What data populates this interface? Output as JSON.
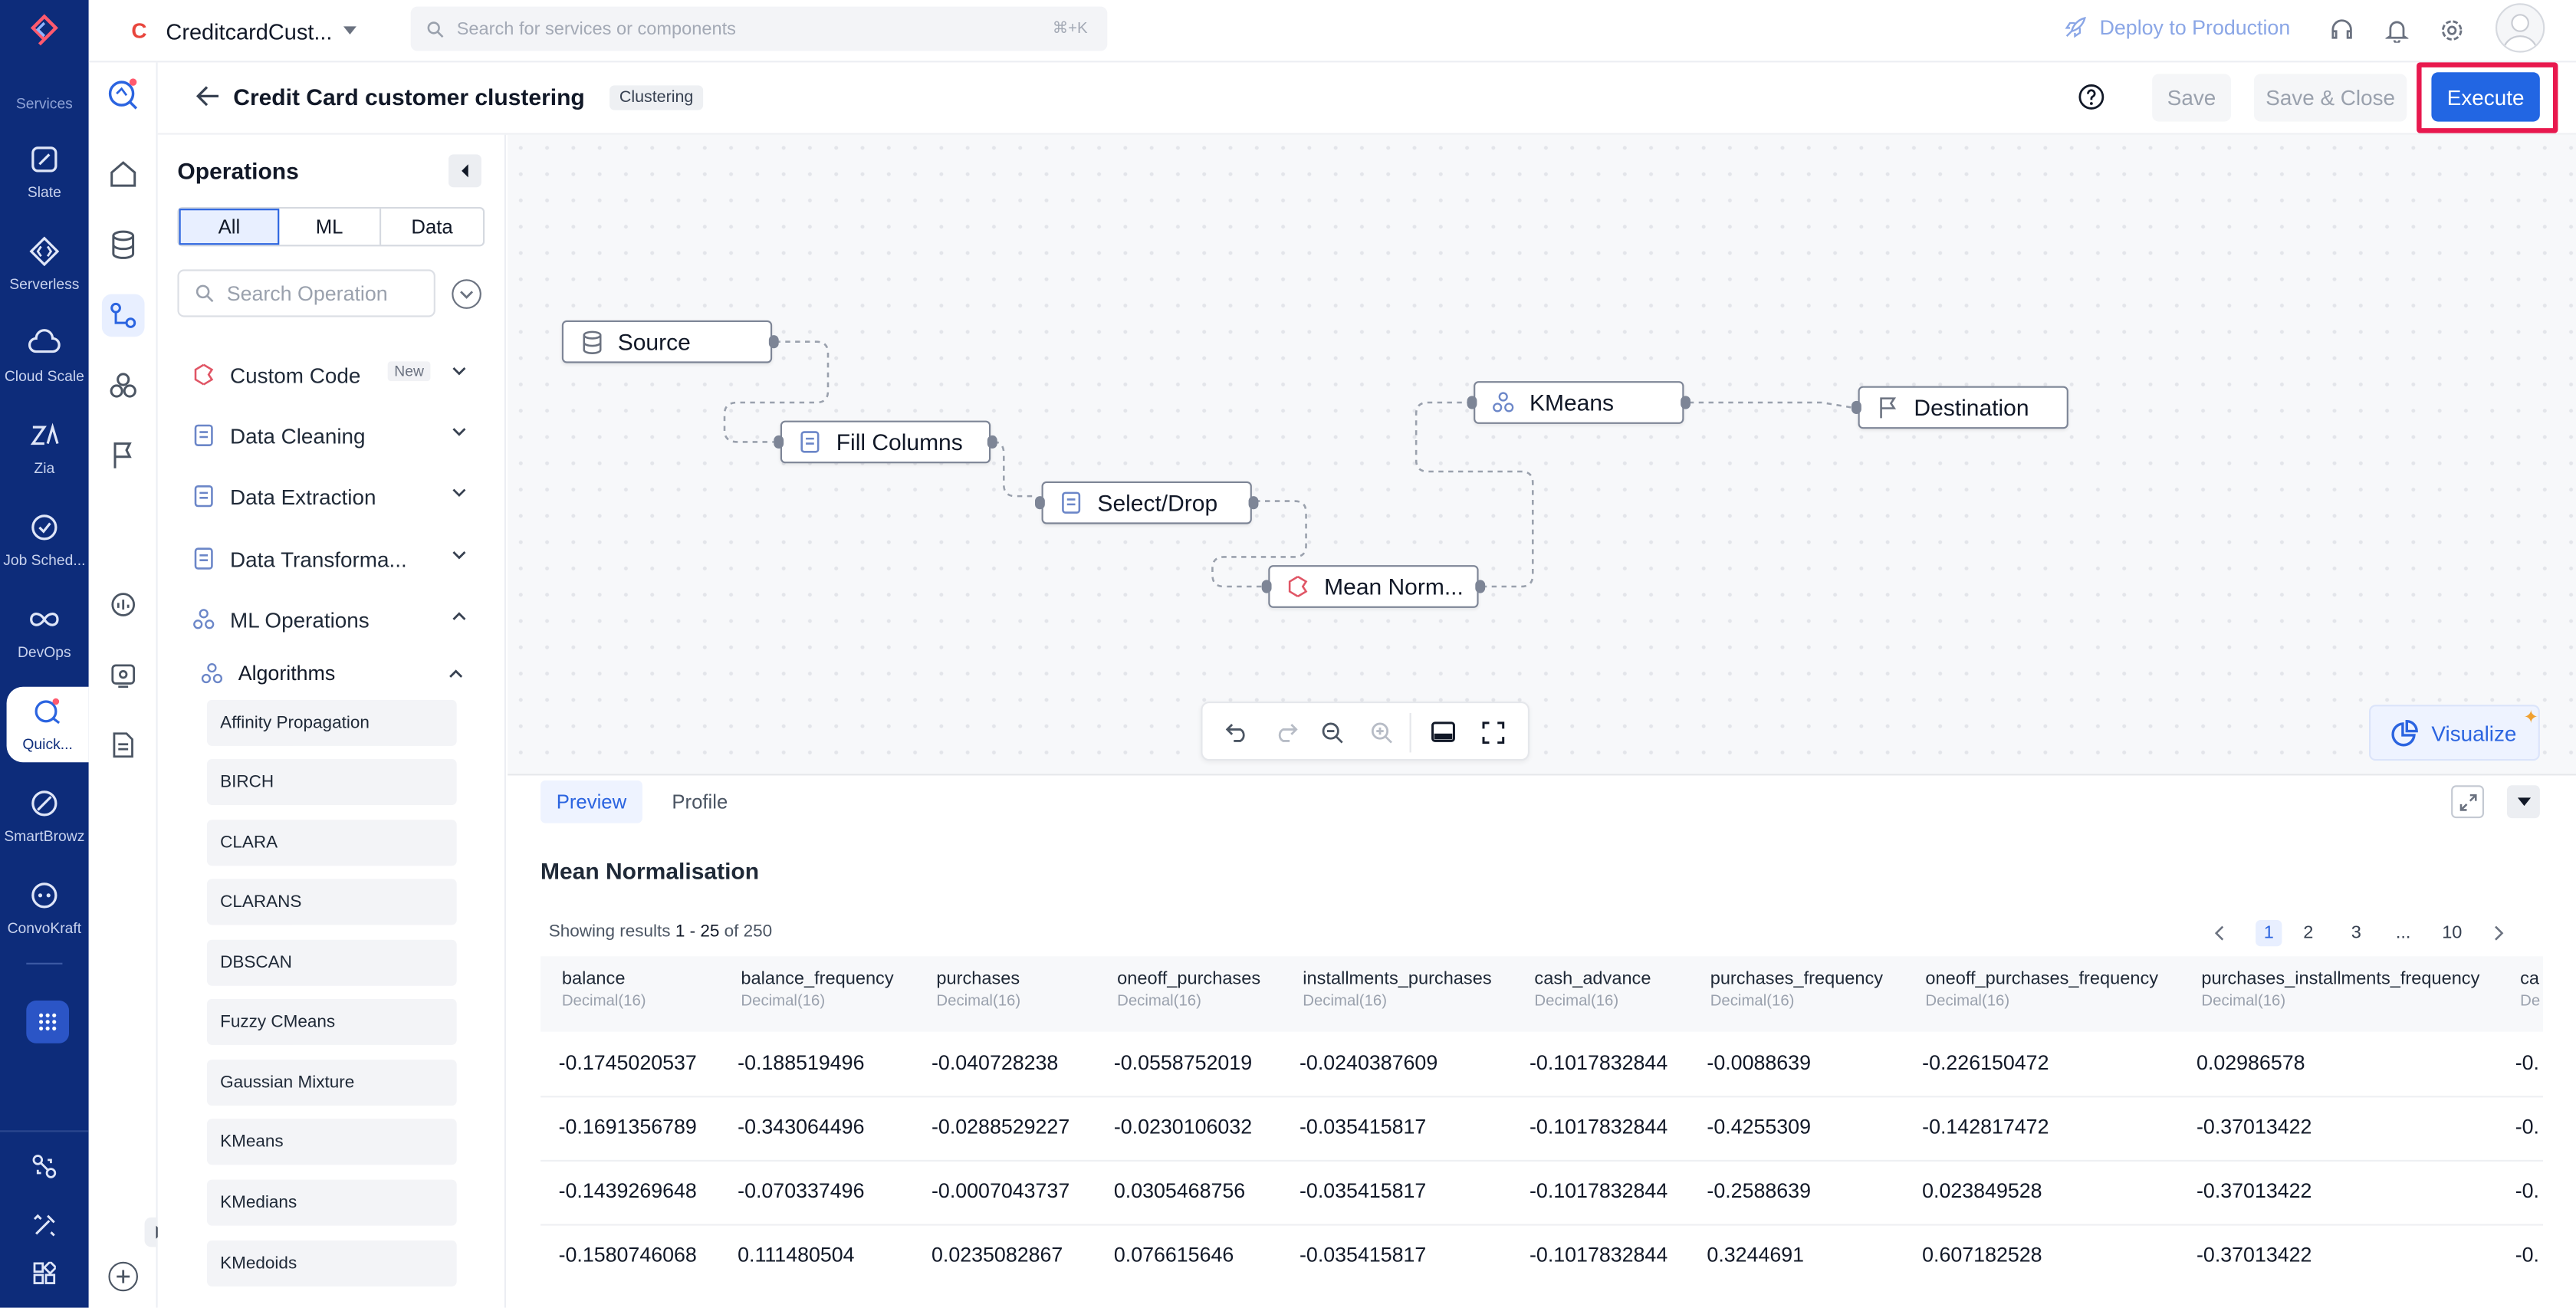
{
  "rail": {
    "section_label": "Services",
    "items": [
      {
        "label": "Slate"
      },
      {
        "label": "Serverless"
      },
      {
        "label": "Cloud Scale"
      },
      {
        "label": "Zia"
      },
      {
        "label": "Job Sched..."
      },
      {
        "label": "DevOps"
      },
      {
        "label": "Quick..."
      },
      {
        "label": "SmartBrowz"
      },
      {
        "label": "ConvoKraft"
      }
    ]
  },
  "topbar": {
    "project_initial": "C",
    "project_name": "CreditcardCust...",
    "search_placeholder": "Search for services or components",
    "search_shortcut": "⌘+K",
    "deploy_label": "Deploy to Production"
  },
  "header": {
    "title": "Credit Card customer clustering",
    "badge": "Clustering",
    "save_label": "Save",
    "save_close_label": "Save & Close",
    "execute_label": "Execute"
  },
  "panel": {
    "title": "Operations",
    "filters": [
      "All",
      "ML",
      "Data"
    ],
    "search_placeholder": "Search Operation",
    "categories": [
      {
        "label": "Custom Code",
        "badge": "New"
      },
      {
        "label": "Data Cleaning"
      },
      {
        "label": "Data Extraction"
      },
      {
        "label": "Data Transforma..."
      },
      {
        "label": "ML Operations"
      }
    ],
    "subcategory": "Algorithms",
    "algorithms": [
      "Affinity Propagation",
      "BIRCH",
      "CLARA",
      "CLARANS",
      "DBSCAN",
      "Fuzzy CMeans",
      "Gaussian Mixture",
      "KMeans",
      "KMedians",
      "KMedoids"
    ]
  },
  "canvas": {
    "nodes": {
      "source": "Source",
      "fill": "Fill Columns",
      "select": "Select/Drop",
      "mean": "Mean Norm...",
      "kmeans": "KMeans",
      "destination": "Destination"
    },
    "visualize_label": "Visualize"
  },
  "preview": {
    "tabs": [
      "Preview",
      "Profile"
    ],
    "title": "Mean Normalisation",
    "results_prefix": "Showing results ",
    "results_range": "1 - 25",
    "results_suffix": " of 250",
    "pages": [
      "1",
      "2",
      "3",
      "...",
      "10"
    ],
    "columns": [
      {
        "name": "balance",
        "type": "Decimal(16)"
      },
      {
        "name": "balance_frequency",
        "type": "Decimal(16)"
      },
      {
        "name": "purchases",
        "type": "Decimal(16)"
      },
      {
        "name": "oneoff_purchases",
        "type": "Decimal(16)"
      },
      {
        "name": "installments_purchases",
        "type": "Decimal(16)"
      },
      {
        "name": "cash_advance",
        "type": "Decimal(16)"
      },
      {
        "name": "purchases_frequency",
        "type": "Decimal(16)"
      },
      {
        "name": "oneoff_purchases_frequency",
        "type": "Decimal(16)"
      },
      {
        "name": "purchases_installments_frequency",
        "type": "Decimal(16)"
      },
      {
        "name": "ca",
        "type": "De"
      }
    ],
    "rows": [
      [
        "-0.1745020537",
        "-0.188519496",
        "-0.040728238",
        "-0.0558752019",
        "-0.0240387609",
        "-0.1017832844",
        "-0.0088639",
        "-0.226150472",
        "0.02986578",
        "-0."
      ],
      [
        "-0.1691356789",
        "-0.343064496",
        "-0.0288529227",
        "-0.0230106032",
        "-0.035415817",
        "-0.1017832844",
        "-0.4255309",
        "-0.142817472",
        "-0.37013422",
        "-0."
      ],
      [
        "-0.1439269648",
        "-0.070337496",
        "-0.0007043737",
        "0.0305468756",
        "-0.035415817",
        "-0.1017832844",
        "-0.2588639",
        "0.023849528",
        "-0.37013422",
        "-0."
      ],
      [
        "-0.1580746068",
        "0.111480504",
        "0.0235082867",
        "0.076615646",
        "-0.035415817",
        "-0.1017832844",
        "0.3244691",
        "0.607182528",
        "-0.37013422",
        "-0."
      ]
    ]
  }
}
